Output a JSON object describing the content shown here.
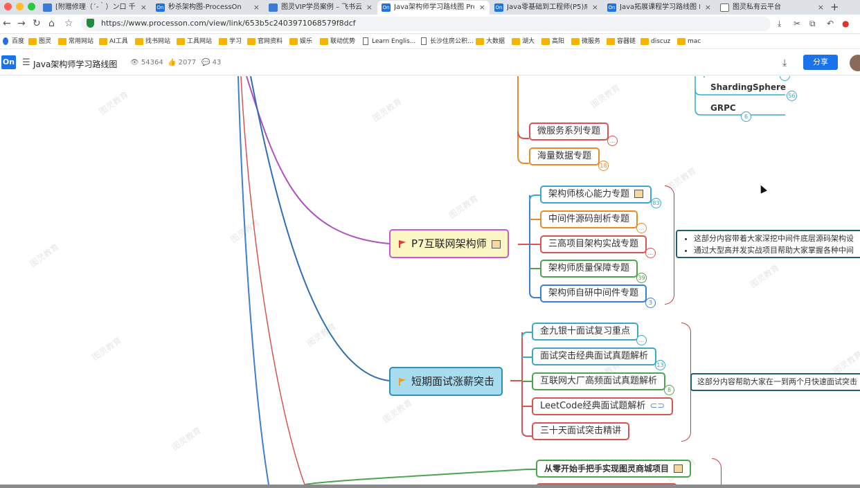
{
  "browser": {
    "tabs": [
      {
        "title": "[附赠修理（´-｀）ン口 千杯...",
        "favicon": "doc-icon"
      },
      {
        "title": "秒杀架构图-ProcessOn",
        "favicon": "On"
      },
      {
        "title": "图灵VIP学员案例 – 飞书云...",
        "favicon": "doc-icon"
      },
      {
        "title": "Java架构师学习路线图 Pro...",
        "favicon": "On"
      },
      {
        "title": "Java零基础到工程师(P5)成...",
        "favicon": "On"
      },
      {
        "title": "Java拓展课程学习路线图 Pro...",
        "favicon": "On"
      },
      {
        "title": "图灵私有云平台",
        "favicon": "doc-icon"
      }
    ],
    "url": "https://www.processon.com/view/link/653b5c2403971068579f8dcf",
    "bookmarks": [
      "百度",
      "图灵",
      "常用网站",
      "AI工具",
      "找书网站",
      "工具网站",
      "学习",
      "官网资料",
      "娱乐",
      "联动优势",
      "Learn Englis...",
      "长沙住房公积...",
      "大数据",
      "湖大",
      "高阳",
      "微服务",
      "容器链",
      "discuz",
      "mac"
    ]
  },
  "app": {
    "logo": "On",
    "title": "Java架构师学习路线图",
    "views": "54364",
    "likes": "2077",
    "comments": "43",
    "share_label": "分享"
  },
  "watermark": "图灵教育",
  "mindmap": {
    "top_items": [
      {
        "label": "ShardingSphere",
        "count": "56"
      },
      {
        "label": "GRPC",
        "count": "6"
      }
    ],
    "upper_topics": [
      {
        "label": "微服务系列专题",
        "badge": "...",
        "color": "#d9534f"
      },
      {
        "label": "海量数据专题",
        "badge": "18",
        "color": "#e8892e"
      }
    ],
    "p7": {
      "label": "P7互联网架构师",
      "topics": [
        {
          "label": "架构师核心能力专题",
          "badge": "83",
          "color": "#3aa8c9",
          "note": true
        },
        {
          "label": "中间件源码剖析专题",
          "badge": "...",
          "color": "#e8892e"
        },
        {
          "label": "三高项目架构实战专题",
          "badge": "...",
          "color": "#d9534f"
        },
        {
          "label": "架构师质量保障专题",
          "badge": "39",
          "color": "#4fa34f"
        },
        {
          "label": "架构师自研中间件专题",
          "badge": "3",
          "color": "#3b7fd4"
        }
      ],
      "summary": [
        "这部分内容带着大家深挖中间件底层源码架构设",
        "通过大型高并发实战项目帮助大家掌握各种中间"
      ]
    },
    "interview": {
      "label": "短期面试涨薪突击",
      "topics": [
        {
          "label": "金九银十面试复习重点",
          "badge": "...",
          "color": "#3aa8c9"
        },
        {
          "label": "面试突击经典面试真题解析",
          "badge": "13",
          "color": "#3aa8c9"
        },
        {
          "label": "互联网大厂高频面试真题解析",
          "badge": "8",
          "color": "#4fa34f"
        },
        {
          "label": "LeetCode经典面试题解析",
          "badge": "",
          "color": "#d9534f",
          "link": true
        },
        {
          "label": "三十天面试突击精讲",
          "badge": "",
          "color": "#d9534f"
        }
      ],
      "summary": "这部分内容帮助大家在一到两个月快速面试突击"
    },
    "bottom_topic": {
      "label": "从零开始手把手实现图灵商城项目",
      "color": "#4fa34f",
      "note": true
    }
  }
}
